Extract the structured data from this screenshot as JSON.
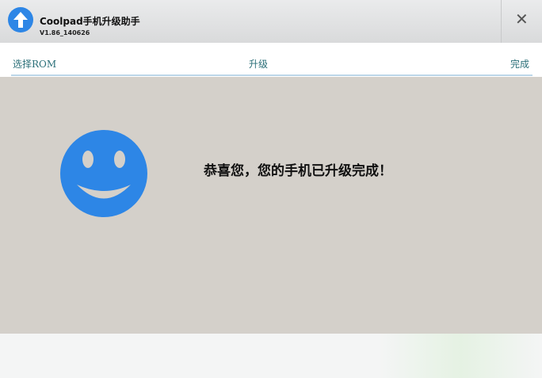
{
  "app": {
    "title": "Coolpad手机升级助手",
    "version": "V1.86_140626"
  },
  "steps": [
    "选择ROM",
    "升级",
    "完成"
  ],
  "message": "恭喜您，您的手机已升级完成！"
}
